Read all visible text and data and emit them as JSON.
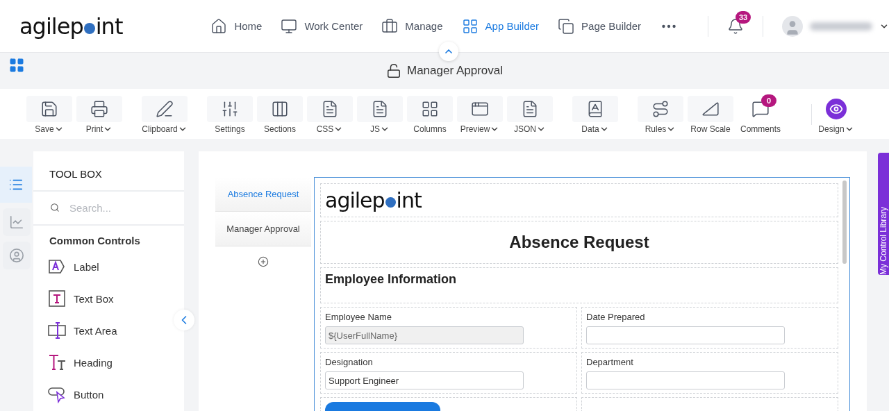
{
  "header": {
    "logo": {
      "parts": [
        "agilep",
        "int"
      ]
    },
    "nav": [
      {
        "label": "Home",
        "selected": false
      },
      {
        "label": "Work Center",
        "selected": false
      },
      {
        "label": "Manage",
        "selected": false
      },
      {
        "label": "App Builder",
        "selected": true
      },
      {
        "label": "Page Builder",
        "selected": false
      }
    ],
    "notifications": {
      "count": "33"
    }
  },
  "subheader": {
    "title": "Manager Approval"
  },
  "toolbar": {
    "groups": [
      [
        {
          "label": "Save",
          "menu": true
        },
        {
          "label": "Print",
          "menu": true
        }
      ],
      [
        {
          "label": "Clipboard",
          "menu": true
        }
      ],
      [
        {
          "label": "Settings",
          "menu": false
        },
        {
          "label": "Sections",
          "menu": false
        },
        {
          "label": "CSS",
          "menu": true
        },
        {
          "label": "JS",
          "menu": true
        },
        {
          "label": "Columns",
          "menu": false
        },
        {
          "label": "Preview",
          "menu": true
        },
        {
          "label": "JSON",
          "menu": true
        }
      ],
      [
        {
          "label": "Data",
          "menu": true
        }
      ],
      [
        {
          "label": "Rules",
          "menu": true
        },
        {
          "label": "Row Scale",
          "menu": false
        },
        {
          "label": "Comments",
          "menu": false,
          "badge": "0"
        }
      ]
    ],
    "mode": {
      "label": "Design",
      "menu": true
    }
  },
  "rail": [
    {
      "selected": true
    },
    {
      "selected": false
    },
    {
      "selected": false
    }
  ],
  "toolbox": {
    "title": "TOOL BOX",
    "search": {
      "placeholder": "Search..."
    },
    "section": "Common Controls",
    "items": [
      {
        "label": "Label",
        "kind": "label"
      },
      {
        "label": "Text Box",
        "kind": "textbox"
      },
      {
        "label": "Text Area",
        "kind": "textarea"
      },
      {
        "label": "Heading",
        "kind": "heading"
      },
      {
        "label": "Button",
        "kind": "button"
      }
    ]
  },
  "pages": [
    {
      "label": "Absence Request",
      "selected": true
    },
    {
      "label": "Manager Approval",
      "selected": false
    }
  ],
  "form": {
    "logo": {
      "parts": [
        "agilep",
        "int"
      ]
    },
    "title": "Absence Request",
    "section": "Employee Information",
    "rows": [
      [
        {
          "label": "Employee Name",
          "value": "${UserFullName}",
          "readonly": true
        },
        {
          "label": "Date Prepared",
          "readonly": false
        }
      ],
      [
        {
          "label": "Designation",
          "value": "Support Engineer",
          "readonly": false
        },
        {
          "label": "Department",
          "readonly": false
        }
      ]
    ]
  },
  "side_tab": {
    "label": "My Control Library"
  }
}
